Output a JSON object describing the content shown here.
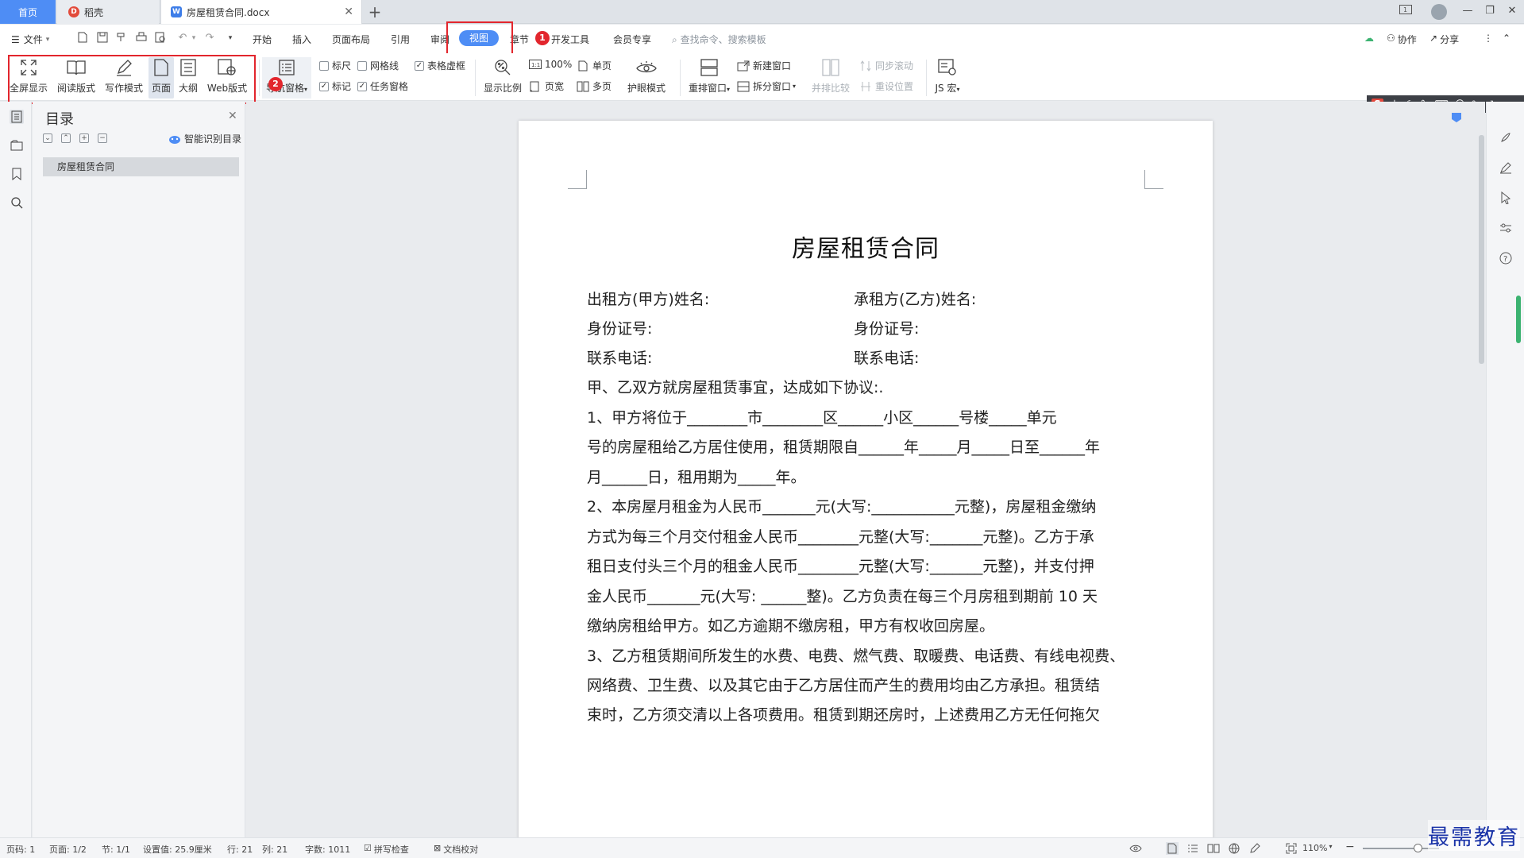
{
  "tabs": {
    "home": "首页",
    "daoke": "稻壳",
    "document": "房屋租赁合同.docx"
  },
  "menu": {
    "file": "文件",
    "items": [
      "开始",
      "插入",
      "页面布局",
      "引用",
      "审阅",
      "视图",
      "章节",
      "开发工具",
      "会员专享"
    ],
    "search_placeholder": "查找命令、搜索模板",
    "collab": "协作",
    "share": "分享"
  },
  "ribbon": {
    "view_modes": [
      "全屏显示",
      "阅读版式",
      "写作模式",
      "页面",
      "大纲",
      "Web版式"
    ],
    "nav_pane": "导航窗格",
    "checkboxes": {
      "ruler": "标尺",
      "gridlines": "网格线",
      "table_gridlines": "表格虚框",
      "markup": "标记",
      "task_pane": "任务窗格"
    },
    "zoom": "显示比例",
    "zoom_100": "100%",
    "page_width": "页宽",
    "single_page": "单页",
    "multi_page": "多页",
    "eye_mode": "护眼模式",
    "arrange_windows": "重排窗口",
    "new_window": "新建窗口",
    "split_window": "拆分窗口",
    "side_by_side": "并排比较",
    "sync_scroll": "同步滚动",
    "reset_position": "重设位置",
    "js_macro": "JS 宏"
  },
  "annotations": {
    "badge1": "1",
    "badge2": "2"
  },
  "toc": {
    "title": "目录",
    "smart": "智能识别目录",
    "items": [
      "房屋租赁合同"
    ]
  },
  "document": {
    "title": "房屋租赁合同",
    "lessor_name": "出租方(甲方)姓名:",
    "lessee_name": "承租方(乙方)姓名:",
    "id_left": "身份证号:",
    "id_right": "身份证号:",
    "phone_left": "联系电话:",
    "phone_right": "联系电话:",
    "paragraphs": [
      "甲、乙双方就房屋租赁事宜，达成如下协议:.",
      "1、甲方将位于________市________区______小区______号楼_____单元",
      "号的房屋租给乙方居住使用，租赁期限自______年_____月_____日至______年",
      "月______日，租用期为_____年。",
      "2、本房屋月租金为人民币_______元(大写:___________元整)，房屋租金缴纳",
      "方式为每三个月交付租金人民币________元整(大写:_______元整)。乙方于承",
      "租日支付头三个月的租金人民币________元整(大写:_______元整)，并支付押",
      "金人民币_______元(大写: ______整)。乙方负责在每三个月房租到期前 10 天",
      "缴纳房租给甲方。如乙方逾期不缴房租，甲方有权收回房屋。",
      "3、乙方租赁期间所发生的水费、电费、燃气费、取暖费、电话费、有线电视费、",
      "网络费、卫生费、以及其它由于乙方居住而产生的费用均由乙方承担。租赁结",
      "束时，乙方须交清以上各项费用。租赁到期还房时，上述费用乙方无任何拖欠"
    ]
  },
  "ime": {
    "lang": "中",
    "extra": "°,"
  },
  "status": {
    "page_num": "页码: 1",
    "pages": "页面: 1/2",
    "section": "节: 1/1",
    "setting": "设置值: 25.9厘米",
    "row": "行: 21",
    "col": "列: 21",
    "words": "字数: 1011",
    "spell": "拼写检查",
    "proof": "文档校对",
    "zoom": "110%"
  },
  "watermark": "最需教育",
  "colors": {
    "accent": "#4e8df5",
    "highlight": "#e2262d"
  }
}
